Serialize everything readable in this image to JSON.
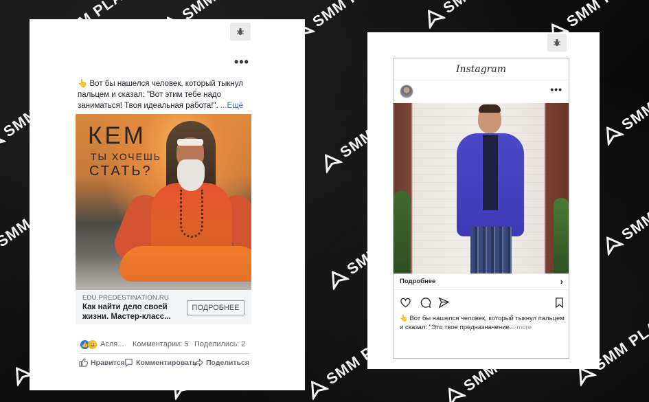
{
  "background": {
    "brand_text": "SMM PLANNER"
  },
  "facebook_post": {
    "post_text": "👆 Вот бы нашелся человек, который тыкнул пальцем и сказал: \"Вот этим тебе надо заниматься! Твоя идеальная работа!\".",
    "more_label": "...Ещё",
    "image_headline_1": "КЕМ",
    "image_headline_2": "ТЫ ХОЧЕШЬ",
    "image_headline_3": "СТАТЬ?",
    "link_domain": "EDU.PREDESTINATION.RU",
    "link_title": "Как найти дело своей жизни. Мастер-класс...",
    "cta_label": "ПОДРОБНЕЕ",
    "reactions_names": "Асля...",
    "comments_count": "Комментарии: 5",
    "shares_count": "Поделились: 2",
    "like_label": "Нравится",
    "comment_label": "Комментировать",
    "share_label": "Поделиться"
  },
  "instagram_post": {
    "app_title": "Instagram",
    "more_info_label": "Подробнее",
    "caption": "👆 Вот бы нашелся человек, который тыкнул пальцем и сказал: \"Это твое предназначение...",
    "more_label": "more"
  },
  "colors": {
    "facebook_link": "#4267b2",
    "like_blue": "#1877f2"
  }
}
